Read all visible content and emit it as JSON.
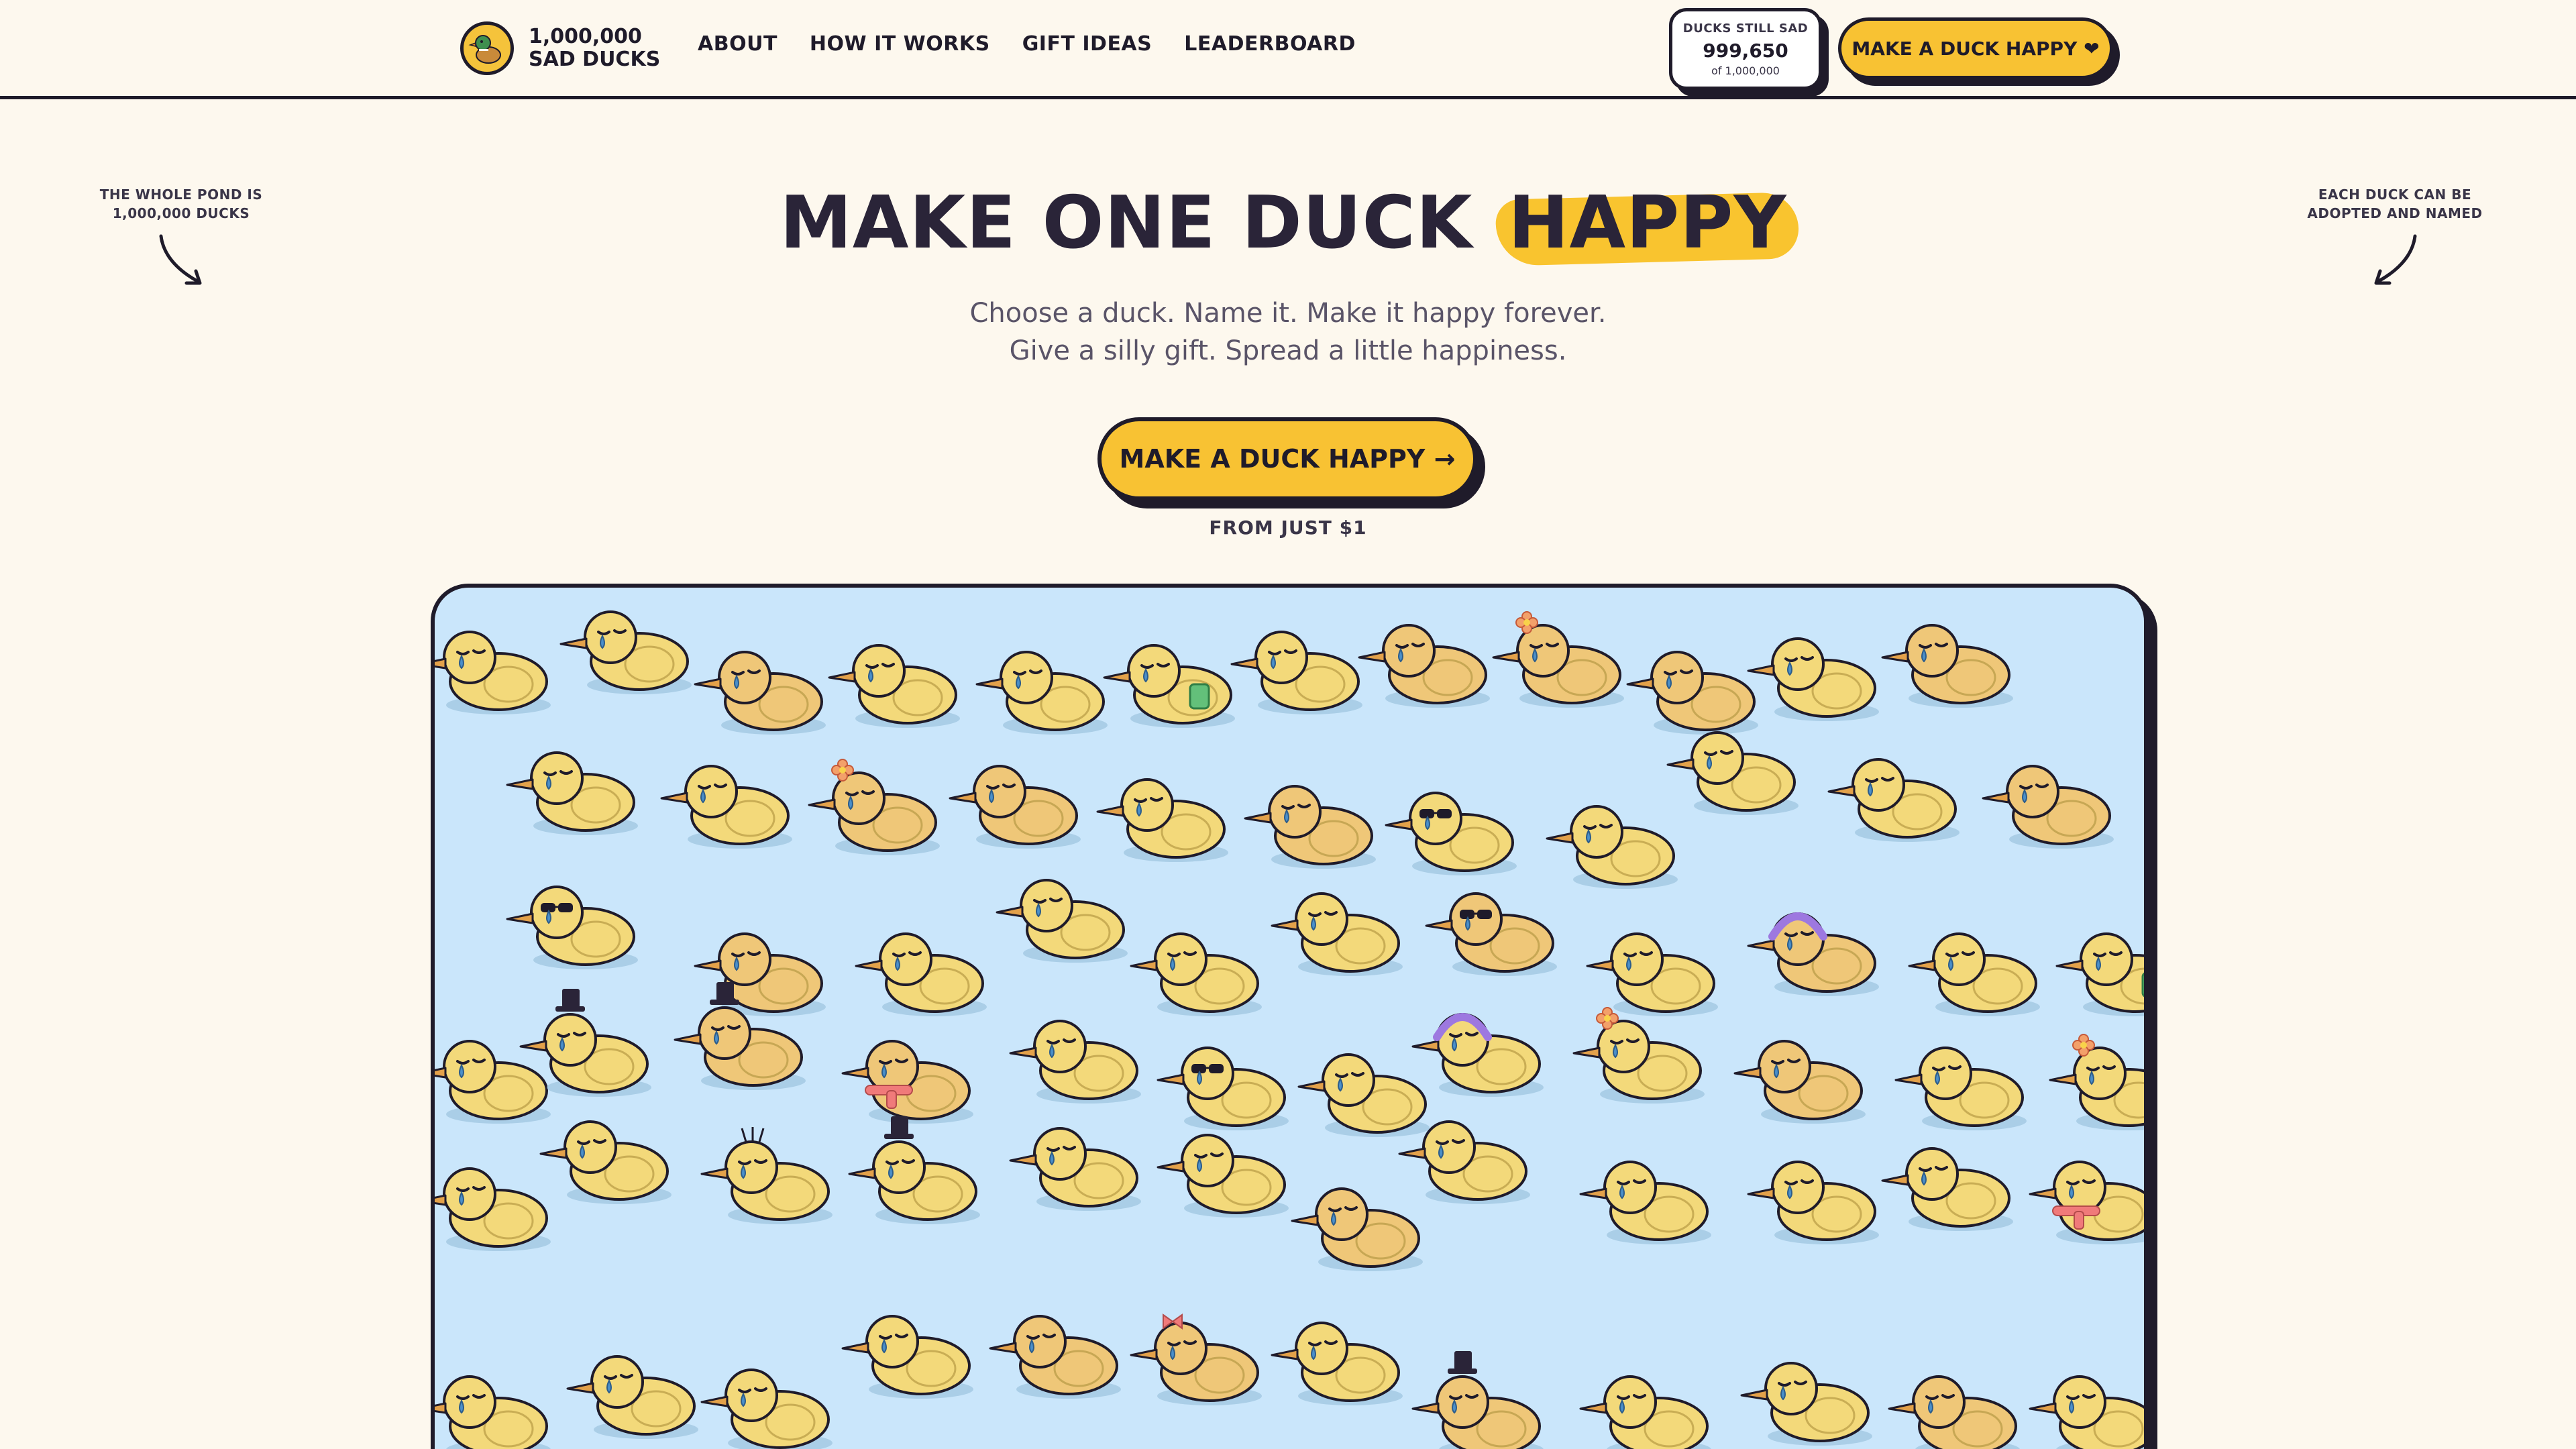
{
  "header": {
    "logo_line1": "1,000,000",
    "logo_line2": "SAD DUCKS",
    "nav": [
      {
        "label": "ABOUT"
      },
      {
        "label": "HOW IT WORKS"
      },
      {
        "label": "GIFT IDEAS"
      },
      {
        "label": "LEADERBOARD"
      }
    ],
    "counter_label": "DUCKS STILL SAD",
    "counter_value": "999,650",
    "counter_sub": "of 1,000,000",
    "cta_label": "MAKE A DUCK HAPPY ❤"
  },
  "hero": {
    "title_main": "MAKE ONE DUCK",
    "title_highlight": "HAPPY",
    "subtitle_1": "Choose a duck. Name it. Make it happy forever.",
    "subtitle_2": "Give a silly gift. Spread a little happiness.",
    "cta_label": "MAKE A DUCK HAPPY →",
    "price_note": "FROM JUST $1",
    "note_left_1": "THE WHOLE POND IS",
    "note_left_2": "1,000,000 DUCKS",
    "note_right_1": "EACH DUCK CAN BE",
    "note_right_2": "ADOPTED AND NAMED"
  },
  "colors": {
    "accent": "#f8c233",
    "outline": "#1f1b2a",
    "background": "#fdf8ee",
    "pond": "#cae6fb",
    "duck_body": "#f3d97a",
    "duck_body_alt": "#efc778",
    "tear": "#4b8fc9"
  },
  "icons": {
    "logo": "duck-logo-icon",
    "cta_heart": "heart-icon",
    "note_arrow": "curved-arrow-icon"
  },
  "pond": {
    "accessories_shown": [
      "top-hat",
      "sunglasses",
      "flower",
      "scarf",
      "headphones",
      "bow",
      "gift-box",
      "antennae"
    ]
  }
}
